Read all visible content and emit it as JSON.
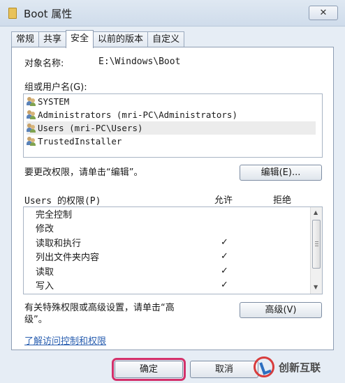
{
  "window": {
    "title": "Boot 属性",
    "close_glyph": "✕"
  },
  "tabs": [
    {
      "label": "常规"
    },
    {
      "label": "共享"
    },
    {
      "label": "安全"
    },
    {
      "label": "以前的版本"
    },
    {
      "label": "自定义"
    }
  ],
  "security": {
    "object_name_label": "对象名称:",
    "object_name_value": "E:\\Windows\\Boot",
    "groups_label": "组或用户名(G):",
    "groups": [
      {
        "name": "SYSTEM"
      },
      {
        "name": "Administrators (mri-PC\\Administrators)"
      },
      {
        "name": "Users (mri-PC\\Users)",
        "selected": true
      },
      {
        "name": "TrustedInstaller"
      }
    ],
    "edit_hint": "要更改权限，请单击“编辑”。",
    "edit_button": "编辑(E)...",
    "permissions_label": "Users 的权限(P)",
    "allow_header": "允许",
    "deny_header": "拒绝",
    "permissions": [
      {
        "name": "完全控制",
        "allow": "",
        "deny": ""
      },
      {
        "name": "修改",
        "allow": "",
        "deny": ""
      },
      {
        "name": "读取和执行",
        "allow": "✓",
        "deny": ""
      },
      {
        "name": "列出文件夹内容",
        "allow": "✓",
        "deny": ""
      },
      {
        "name": "读取",
        "allow": "✓",
        "deny": ""
      },
      {
        "name": "写入",
        "allow": "✓",
        "deny": ""
      }
    ],
    "advanced_hint_line1": "有关特殊权限或高级设置，请单击“高",
    "advanced_hint_line2": "级”。",
    "advanced_button": "高级(V)",
    "learn_link": "了解访问控制和权限"
  },
  "footer": {
    "ok_button": "确定",
    "cancel_button": "取消"
  },
  "watermark": {
    "text": "创新互联"
  },
  "colors": {
    "highlight": "#d3306a",
    "link": "#2a5fb0"
  }
}
